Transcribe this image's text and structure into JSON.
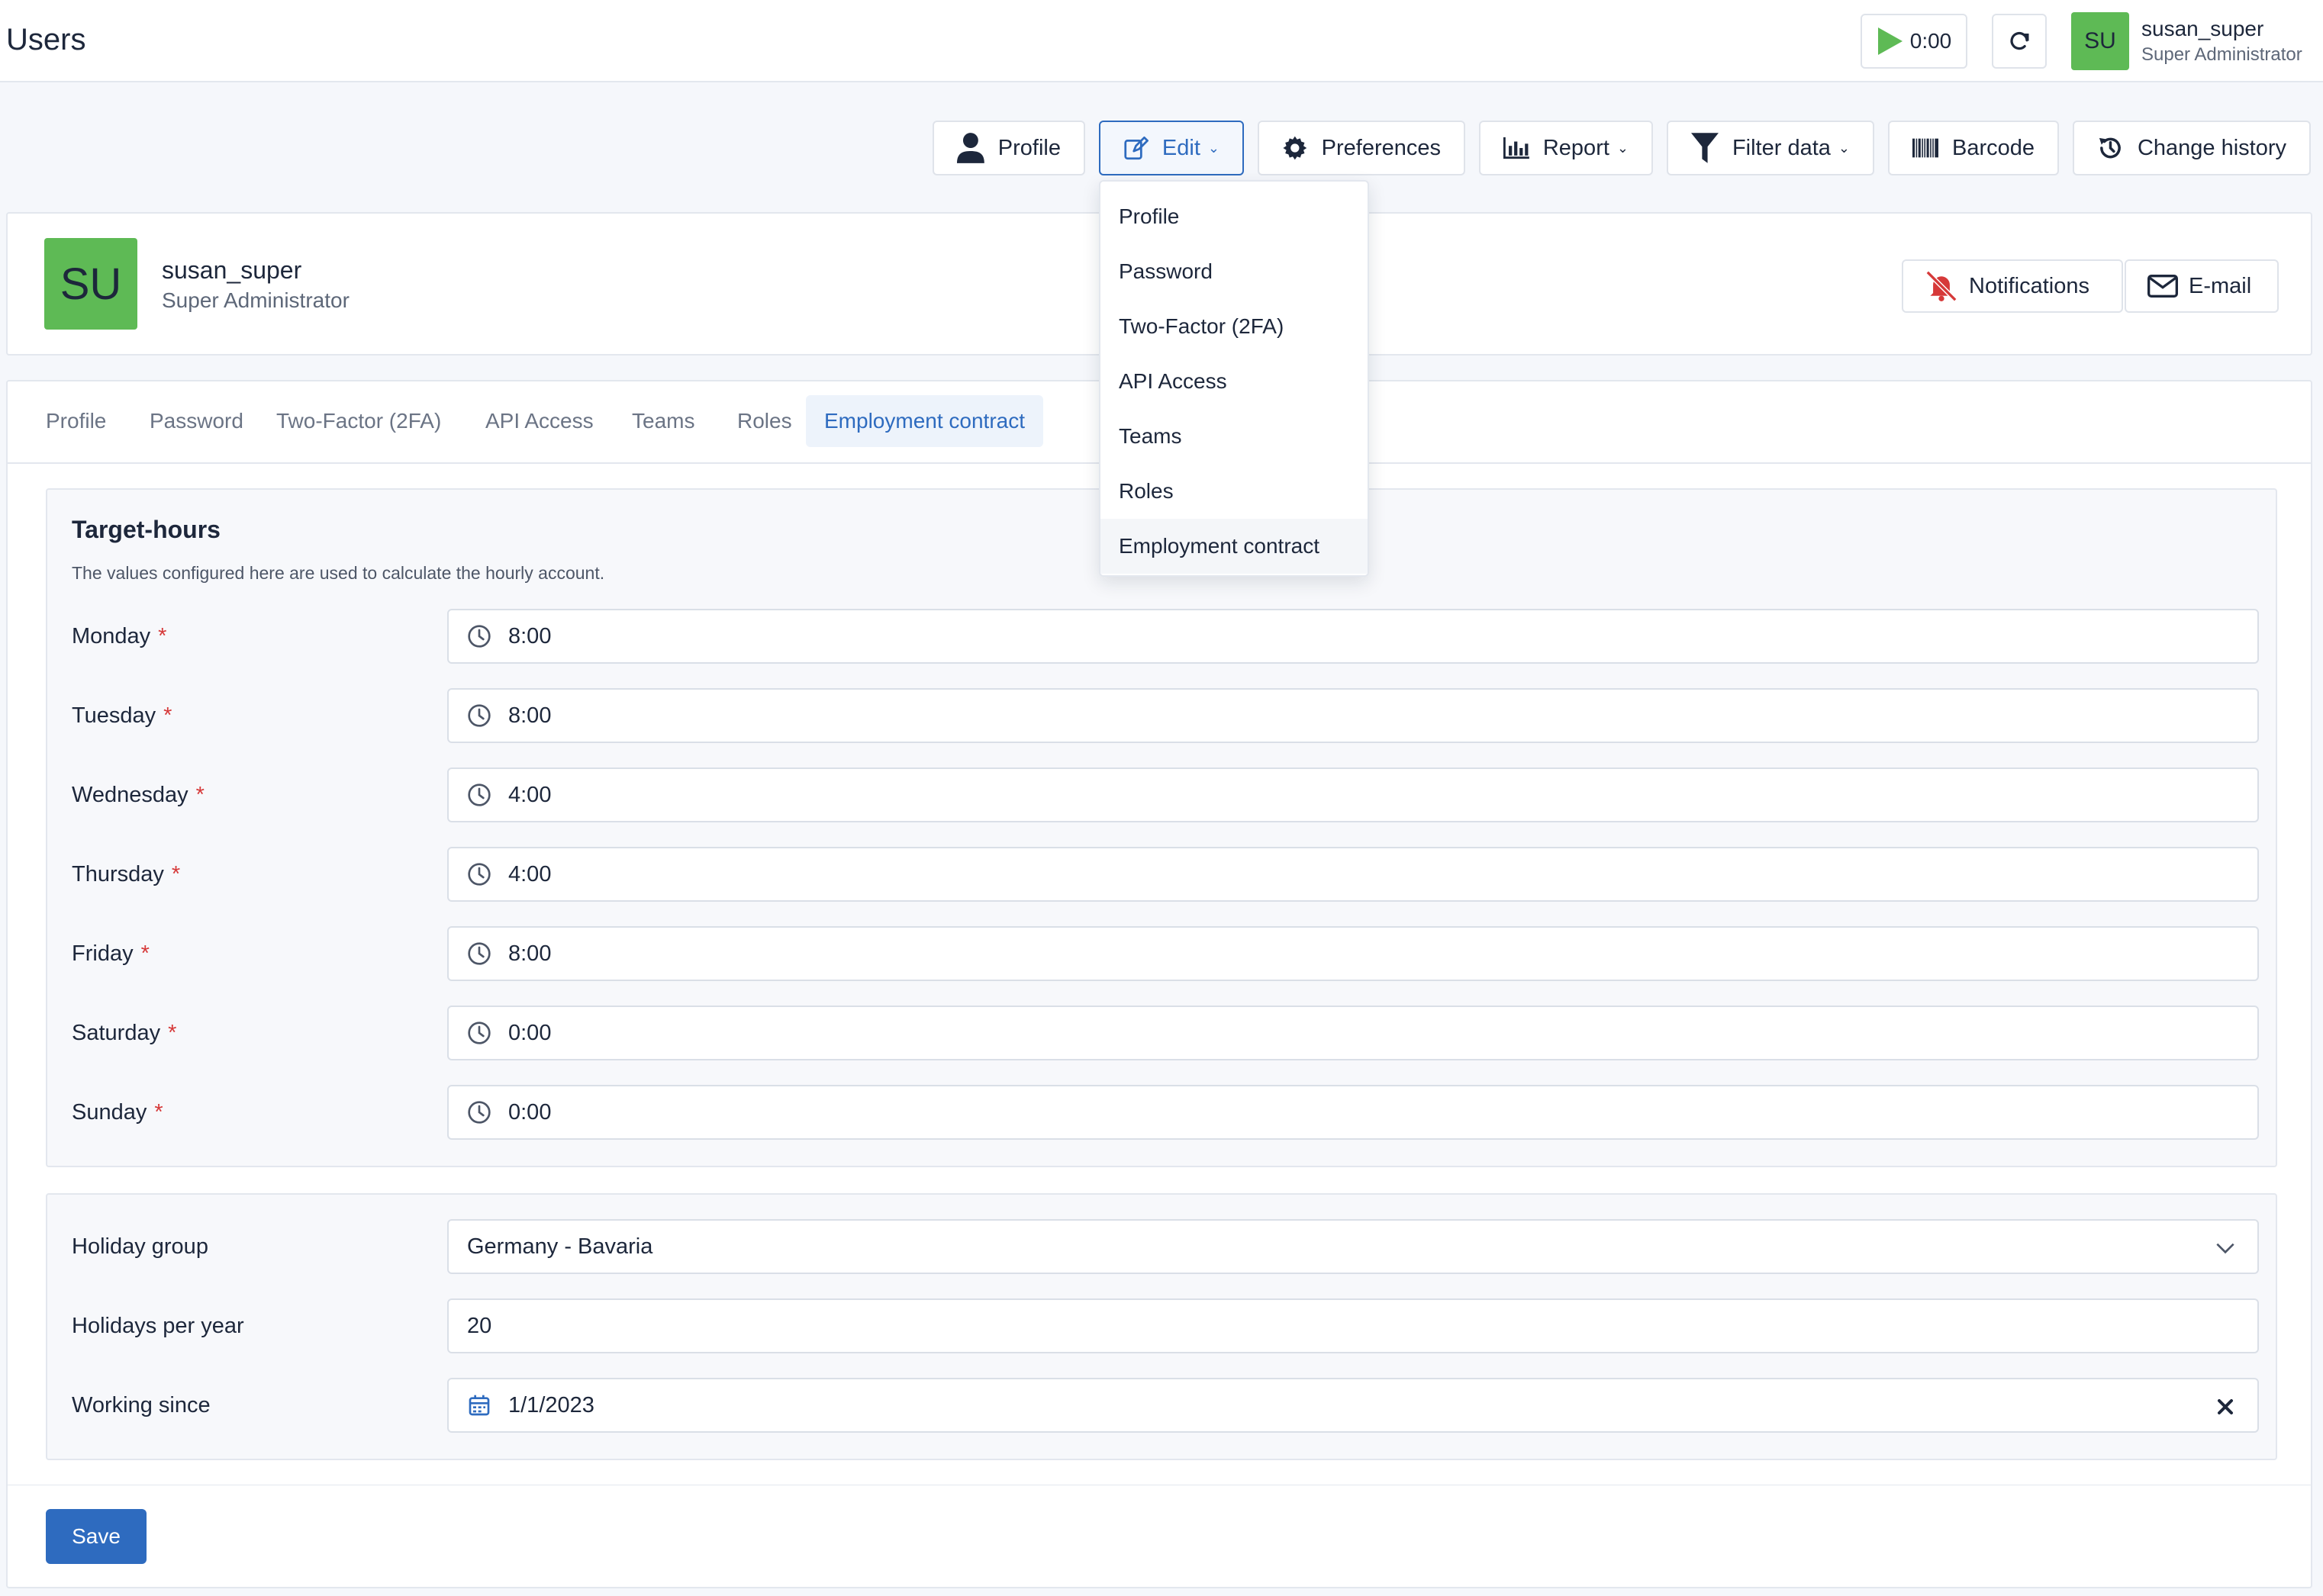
{
  "header": {
    "title": "Users",
    "timer": "0:00",
    "user_initials": "SU",
    "user_name": "susan_super",
    "user_role": "Super Administrator"
  },
  "toolbar": {
    "profile": "Profile",
    "edit": "Edit",
    "preferences": "Preferences",
    "report": "Report",
    "filter": "Filter data",
    "barcode": "Barcode",
    "history": "Change history"
  },
  "edit_menu": {
    "items": [
      "Profile",
      "Password",
      "Two-Factor (2FA)",
      "API Access",
      "Teams",
      "Roles",
      "Employment contract"
    ],
    "highlighted": "Employment contract"
  },
  "user_card": {
    "initials": "SU",
    "name": "susan_super",
    "role": "Super Administrator",
    "notifications": "Notifications",
    "email": "E-mail"
  },
  "tabs": {
    "items": [
      "Profile",
      "Password",
      "Two-Factor (2FA)",
      "API Access",
      "Teams",
      "Roles",
      "Employment contract"
    ],
    "active": "Employment contract"
  },
  "target_hours": {
    "title": "Target-hours",
    "hint": "The values configured here are used to calculate the hourly account.",
    "days": [
      {
        "label": "Monday",
        "value": "8:00"
      },
      {
        "label": "Tuesday",
        "value": "8:00"
      },
      {
        "label": "Wednesday",
        "value": "4:00"
      },
      {
        "label": "Thursday",
        "value": "4:00"
      },
      {
        "label": "Friday",
        "value": "8:00"
      },
      {
        "label": "Saturday",
        "value": "0:00"
      },
      {
        "label": "Sunday",
        "value": "0:00"
      }
    ],
    "required_mark": "*"
  },
  "holidays": {
    "group_label": "Holiday group",
    "group_value": "Germany - Bavaria",
    "per_year_label": "Holidays per year",
    "per_year_value": "20",
    "since_label": "Working since",
    "since_value": "1/1/2023"
  },
  "actions": {
    "save": "Save"
  },
  "colors": {
    "primary": "#2e6bbf",
    "avatar": "#5eba55",
    "required": "#d63939",
    "timer_play": "#5eba55",
    "notifications_icon": "#d63939"
  }
}
